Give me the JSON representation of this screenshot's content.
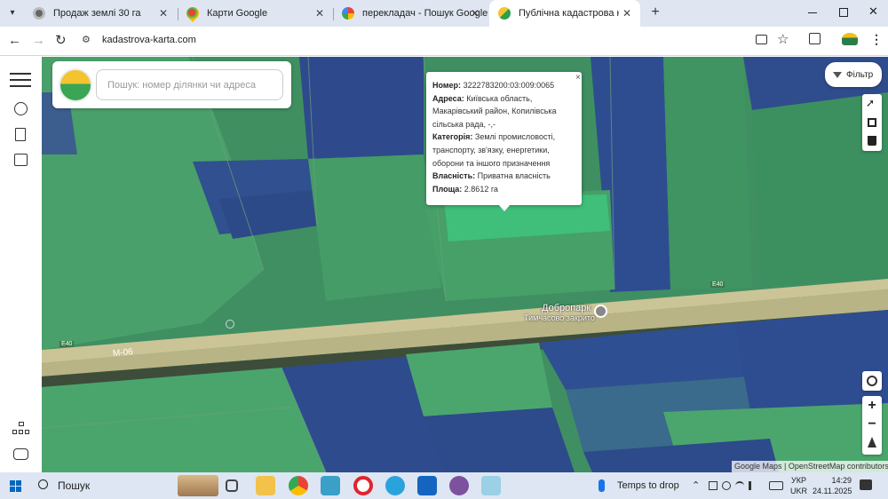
{
  "tabs": [
    {
      "label": "Продаж землі 30 га",
      "icon": "site-icon"
    },
    {
      "label": "Карти Google",
      "icon": "maps-icon"
    },
    {
      "label": "перекладач - Пошук Google",
      "icon": "google-icon"
    },
    {
      "label": "Публічна кадастрова карта Ук",
      "icon": "cadastre-icon"
    }
  ],
  "address": {
    "url": "kadastrova-karta.com"
  },
  "search": {
    "placeholder": "Пошук: номер ділянки чи адреса"
  },
  "filter_label": "Фільтр",
  "popup": {
    "number_label": "Номер:",
    "number": "3222783200:03:009:0065",
    "address_label": "Адреса:",
    "address": "Київська область, Макарівський район, Копилівська сільська рада, -,-",
    "category_label": "Категорія:",
    "category": "Землі промисловості, транспорту, зв'язку, енергетики, оборони та іншого призначення",
    "ownership_label": "Власність:",
    "ownership": "Приватна власність",
    "area_label": "Площа:",
    "area": "2.8612 га",
    "close": "×"
  },
  "map_labels": {
    "poi_name": "Добропарк",
    "poi_status": "Тимчасово закрито",
    "road_m06": "М-06",
    "road_e40_left": "E40",
    "road_e40_right": "E40"
  },
  "attribution": {
    "google": "Google Maps",
    "sep": " | ",
    "osm": "OpenStreetMap contributors"
  },
  "taskbar": {
    "search": "Пошук",
    "weather": "Temps to drop",
    "lang_top": "УКР",
    "lang_bottom": "UKR",
    "time": "14:29",
    "date": "24.11.2025"
  },
  "colors": {
    "accent": "#1a73e8",
    "parcel_green": "#4aa56c",
    "parcel_blue": "#2e4d8f",
    "highlight": "#3fbf7a"
  }
}
